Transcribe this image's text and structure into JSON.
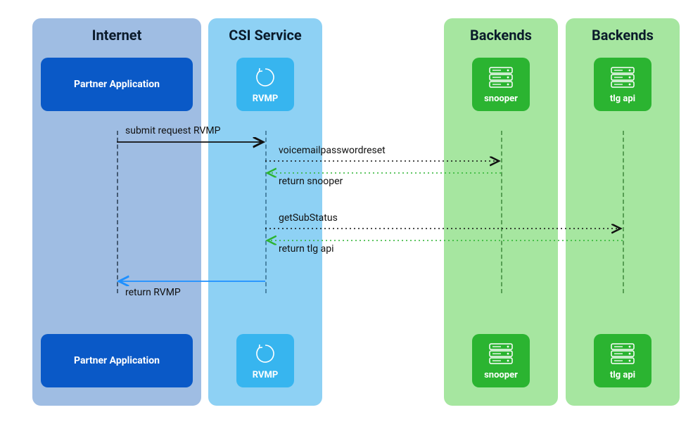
{
  "lanes": {
    "internet": "Internet",
    "csi": "CSI Service",
    "backends1": "Backends",
    "backends2": "Backends"
  },
  "nodes": {
    "partner_app": "Partner Application",
    "rvmp": "RVMP",
    "snooper": "snooper",
    "tlg_api": "tlg api"
  },
  "messages": {
    "submit": "submit request RVMP",
    "vm_reset": "voicemailpasswordreset",
    "return_snooper": "return snooper",
    "get_sub_status": "getSubStatus",
    "return_tlg": "return tlg api",
    "return_rvmp": "return RVMP"
  },
  "colors": {
    "lane_internet": "#9fbde3",
    "lane_csi": "#8ed1f4",
    "lane_backend": "#a6e6a0",
    "node_blue": "#0a59c7",
    "node_cyan": "#37b5ef",
    "node_green": "#2bb431",
    "arrow_black": "#111111",
    "arrow_blue": "#1e90ff",
    "arrow_green": "#2bb431"
  },
  "chart_data": {
    "type": "sequence-diagram",
    "participants": [
      {
        "id": "partner",
        "lane": "Internet",
        "label": "Partner Application"
      },
      {
        "id": "rvmp",
        "lane": "CSI Service",
        "label": "RVMP"
      },
      {
        "id": "snooper",
        "lane": "Backends",
        "label": "snooper"
      },
      {
        "id": "tlg",
        "lane": "Backends",
        "label": "tlg api"
      }
    ],
    "messages": [
      {
        "from": "partner",
        "to": "rvmp",
        "label": "submit request RVMP",
        "style": "solid",
        "color": "black"
      },
      {
        "from": "rvmp",
        "to": "snooper",
        "label": "voicemailpasswordreset",
        "style": "dotted",
        "color": "black"
      },
      {
        "from": "snooper",
        "to": "rvmp",
        "label": "return snooper",
        "style": "dotted",
        "color": "green"
      },
      {
        "from": "rvmp",
        "to": "tlg",
        "label": "getSubStatus",
        "style": "dotted",
        "color": "black"
      },
      {
        "from": "tlg",
        "to": "rvmp",
        "label": "return tlg api",
        "style": "dotted",
        "color": "green"
      },
      {
        "from": "rvmp",
        "to": "partner",
        "label": "return RVMP",
        "style": "solid",
        "color": "blue"
      }
    ]
  }
}
